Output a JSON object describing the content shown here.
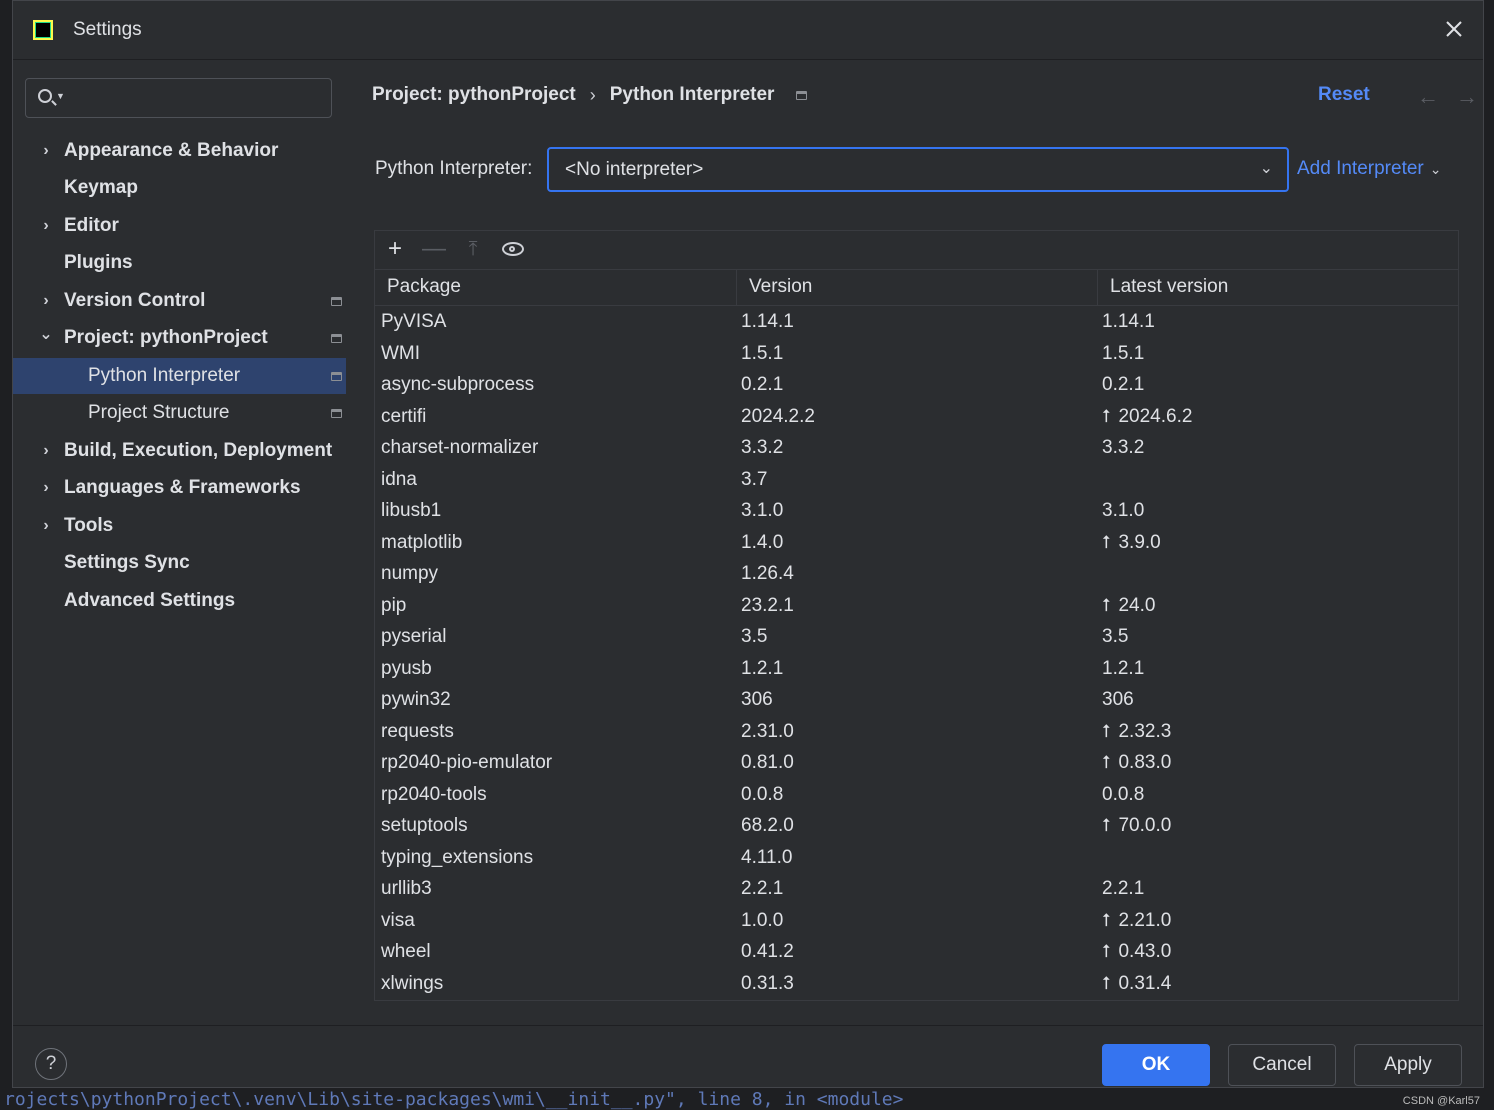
{
  "window": {
    "title": "Settings"
  },
  "search": {
    "placeholder": ""
  },
  "sidebar": {
    "items": [
      {
        "label": "Appearance & Behavior",
        "chevron": "›"
      },
      {
        "label": "Keymap"
      },
      {
        "label": "Editor",
        "chevron": "›"
      },
      {
        "label": "Plugins"
      },
      {
        "label": "Version Control",
        "chevron": "›"
      },
      {
        "label": "Project: pythonProject",
        "chevron": "⌄"
      },
      {
        "label": "Python Interpreter"
      },
      {
        "label": "Project Structure"
      },
      {
        "label": "Build, Execution, Deployment",
        "chevron": "›"
      },
      {
        "label": "Languages & Frameworks",
        "chevron": "›"
      },
      {
        "label": "Tools",
        "chevron": "›"
      },
      {
        "label": "Settings Sync"
      },
      {
        "label": "Advanced Settings"
      }
    ]
  },
  "breadcrumb": {
    "parent": "Project: pythonProject",
    "separator": "›",
    "current": "Python Interpreter"
  },
  "header": {
    "reset_label": "Reset",
    "back_arrow": "←",
    "forward_arrow": "→"
  },
  "interpreter": {
    "label": "Python Interpreter:",
    "selected": "<No interpreter>",
    "add_label": "Add Interpreter"
  },
  "toolbar": {
    "add": "+",
    "remove": "—",
    "upgrade": "⤒"
  },
  "table": {
    "headers": [
      "Package",
      "Version",
      "Latest version"
    ],
    "rows": [
      {
        "package": "PyVISA",
        "version": "1.14.1",
        "latest": "1.14.1",
        "upgrade": false
      },
      {
        "package": "WMI",
        "version": "1.5.1",
        "latest": "1.5.1",
        "upgrade": false
      },
      {
        "package": "async-subprocess",
        "version": "0.2.1",
        "latest": "0.2.1",
        "upgrade": false
      },
      {
        "package": "certifi",
        "version": "2024.2.2",
        "latest": "2024.6.2",
        "upgrade": true
      },
      {
        "package": "charset-normalizer",
        "version": "3.3.2",
        "latest": "3.3.2",
        "upgrade": false
      },
      {
        "package": "idna",
        "version": "3.7",
        "latest": "",
        "upgrade": false
      },
      {
        "package": "libusb1",
        "version": "3.1.0",
        "latest": "3.1.0",
        "upgrade": false
      },
      {
        "package": "matplotlib",
        "version": "1.4.0",
        "latest": "3.9.0",
        "upgrade": true
      },
      {
        "package": "numpy",
        "version": "1.26.4",
        "latest": "",
        "upgrade": false
      },
      {
        "package": "pip",
        "version": "23.2.1",
        "latest": "24.0",
        "upgrade": true
      },
      {
        "package": "pyserial",
        "version": "3.5",
        "latest": "3.5",
        "upgrade": false
      },
      {
        "package": "pyusb",
        "version": "1.2.1",
        "latest": "1.2.1",
        "upgrade": false
      },
      {
        "package": "pywin32",
        "version": "306",
        "latest": "306",
        "upgrade": false
      },
      {
        "package": "requests",
        "version": "2.31.0",
        "latest": "2.32.3",
        "upgrade": true
      },
      {
        "package": "rp2040-pio-emulator",
        "version": "0.81.0",
        "latest": "0.83.0",
        "upgrade": true
      },
      {
        "package": "rp2040-tools",
        "version": "0.0.8",
        "latest": "0.0.8",
        "upgrade": false
      },
      {
        "package": "setuptools",
        "version": "68.2.0",
        "latest": "70.0.0",
        "upgrade": true
      },
      {
        "package": "typing_extensions",
        "version": "4.11.0",
        "latest": "",
        "upgrade": false
      },
      {
        "package": "urllib3",
        "version": "2.2.1",
        "latest": "2.2.1",
        "upgrade": false
      },
      {
        "package": "visa",
        "version": "1.0.0",
        "latest": "2.21.0",
        "upgrade": true
      },
      {
        "package": "wheel",
        "version": "0.41.2",
        "latest": "0.43.0",
        "upgrade": true
      },
      {
        "package": "xlwings",
        "version": "0.31.3",
        "latest": "0.31.4",
        "upgrade": true
      }
    ]
  },
  "footer": {
    "help": "?",
    "ok": "OK",
    "cancel": "Cancel",
    "apply": "Apply"
  },
  "watermark": "CSDN @Karl57",
  "background_code": "rojects\\pythonProject\\.venv\\Lib\\site-packages\\wmi\\__init__.py\", line 8, in <module>",
  "colors": {
    "accent": "#3574f0",
    "link": "#548af7",
    "selected_bg": "#2e436e",
    "panel_bg": "#2b2d30"
  }
}
